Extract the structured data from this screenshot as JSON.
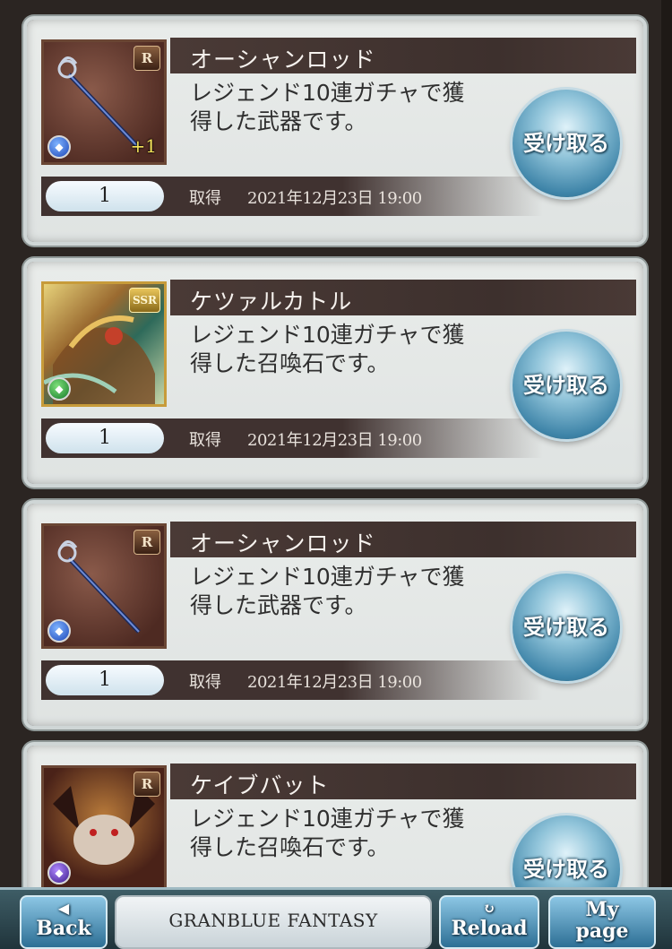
{
  "items": [
    {
      "name": "オーシャンロッド",
      "description_line1": "レジェンド10連ガチャで獲",
      "description_line2": "得した武器です。",
      "rarity": "R",
      "element": "water",
      "plus": "+1",
      "quantity": "1",
      "acquired_label": "取得",
      "acquired_date": "2021年12月23日 19:00",
      "receive_label": "受け取る"
    },
    {
      "name": "ケツァルカトル",
      "description_line1": "レジェンド10連ガチャで獲",
      "description_line2": "得した召喚石です。",
      "rarity": "SSR",
      "element": "wind",
      "plus": "",
      "quantity": "1",
      "acquired_label": "取得",
      "acquired_date": "2021年12月23日 19:00",
      "receive_label": "受け取る"
    },
    {
      "name": "オーシャンロッド",
      "description_line1": "レジェンド10連ガチャで獲",
      "description_line2": "得した武器です。",
      "rarity": "R",
      "element": "water",
      "plus": "",
      "quantity": "1",
      "acquired_label": "取得",
      "acquired_date": "2021年12月23日 19:00",
      "receive_label": "受け取る"
    },
    {
      "name": "ケイブバット",
      "description_line1": "レジェンド10連ガチャで獲",
      "description_line2": "得した召喚石です。",
      "rarity": "R",
      "element": "dark",
      "plus": "",
      "receive_label": "受け取る"
    }
  ],
  "footer": {
    "back_label": "Back",
    "reload_label": "Reload",
    "mypage_label_line1": "My",
    "mypage_label_line2": "page",
    "logo_text": "GRANBLUE FANTASY",
    "back_icon": "arrow-left-icon",
    "reload_icon": "refresh-icon"
  },
  "colors": {
    "card_bg": "#e4e8e7",
    "name_bar": "#423431",
    "receive_button": "#4a8fb3",
    "footer_button": "#5a9cc2"
  }
}
